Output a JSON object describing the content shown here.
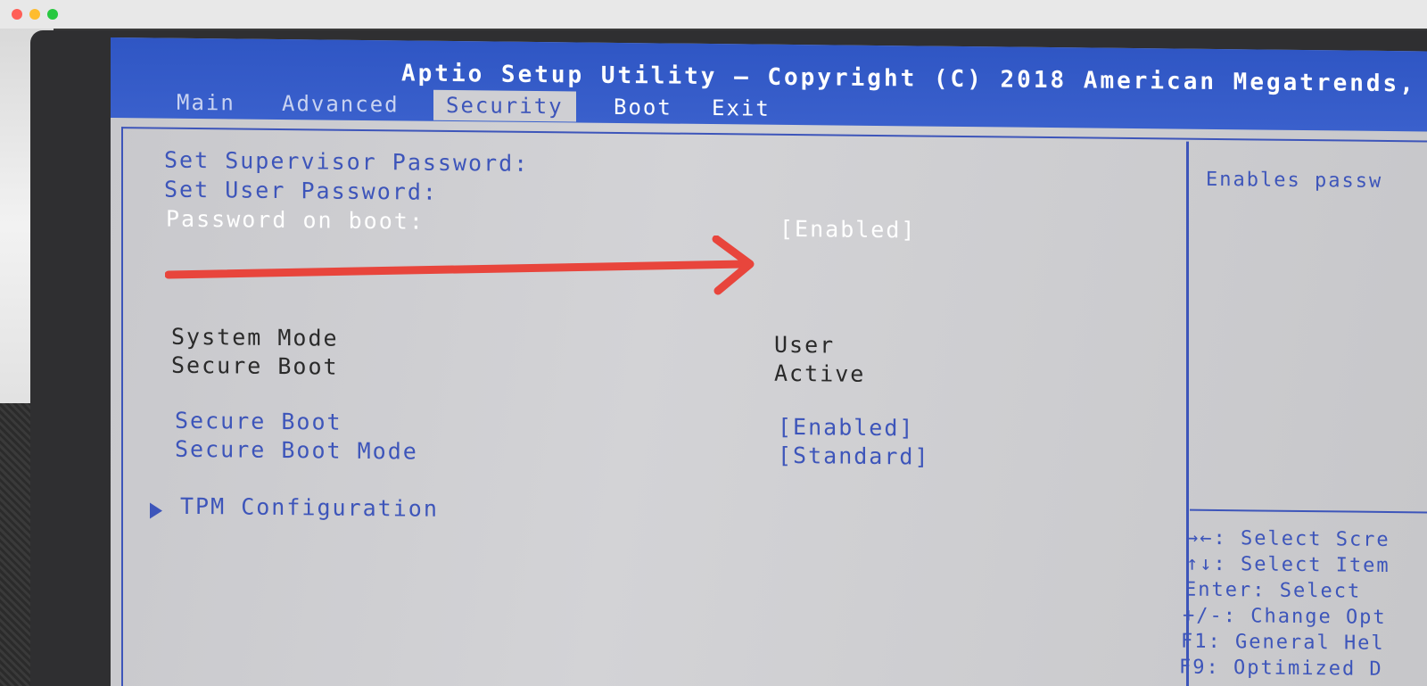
{
  "window": {
    "controls": [
      "close",
      "minimize",
      "maximize"
    ]
  },
  "bios": {
    "title": "Aptio Setup Utility – Copyright (C) 2018 American Megatrends,",
    "tabs": [
      "Main",
      "Advanced",
      "Security",
      "Boot",
      "Exit"
    ],
    "active_tab": "Security",
    "items": {
      "supervisor_password": "Set Supervisor Password:",
      "user_password": "Set User Password:",
      "password_on_boot": "Password on boot:",
      "password_on_boot_value": "[Enabled]",
      "system_mode": "System Mode",
      "system_mode_value": "User",
      "secure_boot_status": "Secure Boot",
      "secure_boot_status_value": "Active",
      "secure_boot": "Secure Boot",
      "secure_boot_value": "[Enabled]",
      "secure_boot_mode": "Secure Boot Mode",
      "secure_boot_mode_value": "[Standard]",
      "tpm_configuration": "TPM Configuration"
    },
    "help_text": "Enables passw",
    "key_help": [
      "→←: Select Scre",
      "↑↓: Select Item",
      "Enter: Select",
      "+/-: Change Opt",
      "F1: General Hel",
      "F9: Optimized D"
    ]
  },
  "colors": {
    "bios_blue": "#3d55ba",
    "header_blue": "#2f56c4",
    "annotation_red": "#e8453c"
  }
}
